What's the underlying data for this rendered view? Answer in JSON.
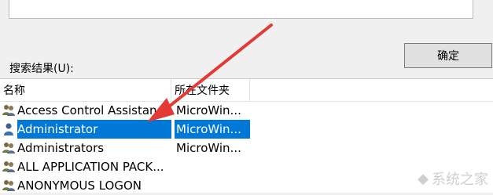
{
  "dialog": {
    "ok_label": "确定",
    "results_label": "搜索结果(U):"
  },
  "columns": {
    "name": "名称",
    "folder": "所在文件夹"
  },
  "rows": [
    {
      "name": "Access Control Assistance Operators",
      "folder": "MicroWin...",
      "icon": "group-users-icon"
    },
    {
      "name": "Administrator",
      "folder": "MicroWin...",
      "icon": "single-user-icon",
      "selected": true
    },
    {
      "name": "Administrators",
      "folder": "MicroWin...",
      "icon": "group-users-icon"
    },
    {
      "name": "ALL APPLICATION PACK...",
      "folder": "",
      "icon": "group-users-icon"
    },
    {
      "name": "ANONYMOUS LOGON",
      "folder": "",
      "icon": "group-users-icon"
    }
  ],
  "annotation": {
    "arrow_color": "#e53935"
  },
  "selection_color": "#0078d7",
  "watermark": {
    "text": "系统之家"
  }
}
